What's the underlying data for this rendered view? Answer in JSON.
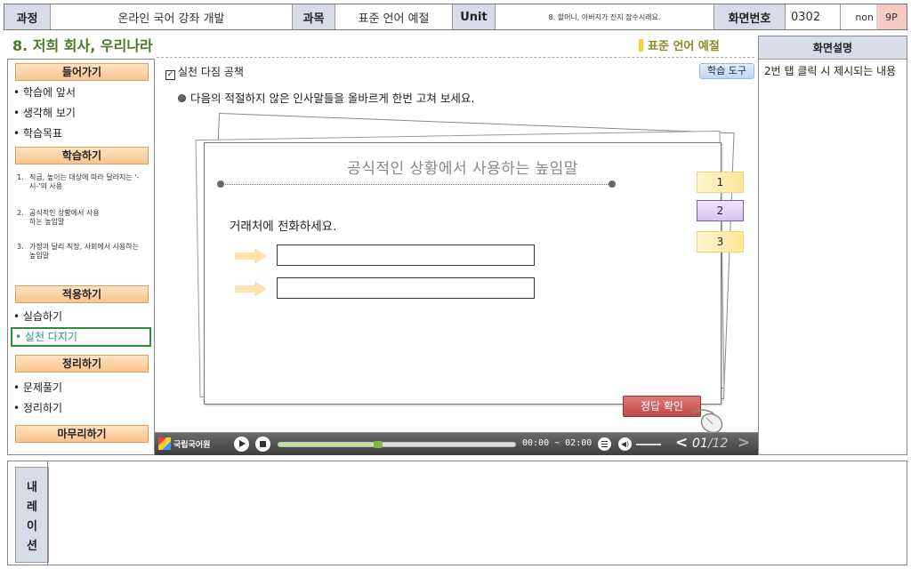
{
  "header": {
    "course_label": "과정",
    "course_value": "온라인 국어 강좌 개발",
    "subject_label": "과목",
    "subject_value": "표준 언어 예절",
    "unit_label": "Unit",
    "unit_value": "8. 할머니, 아버지가 진지 잡수시래요.",
    "screen_label": "화면번호",
    "screen_value": "0302",
    "non_label": "non",
    "page_label": "9P"
  },
  "page_title": "8. 저희 회사, 우리나라",
  "std_label": "표준 언어 예절",
  "nav": {
    "intro_btn": "들어가기",
    "intro_items": [
      "학습에 앞서",
      "생각해 보기",
      "학습목표"
    ],
    "learn_btn": "학습하기",
    "learn_items": [
      {
        "num": "1.",
        "text": "직급, 높이는 대상에 따라 달라지는 '-시-'의 사용"
      },
      {
        "num": "2.",
        "text": "공식적인 상황에서 사용하는 높임말"
      },
      {
        "num": "3.",
        "text": "가정과 달리 직장, 사회에서 사용하는 높임말"
      }
    ],
    "apply_btn": "적용하기",
    "apply_items": [
      "실습하기",
      "실천 다지기"
    ],
    "summary_btn": "정리하기",
    "summary_items": [
      "문제풀기",
      "정리하기"
    ],
    "finish_btn": "마무리하기"
  },
  "main": {
    "section_title": "실천 다짐 공책",
    "tool_button": "학습 도구",
    "instruction": "다음의 적절하지 않은 인사말들을 올바르게 한번 고쳐 보세요.",
    "card_title": "공식적인 상황에서 사용하는 높임말",
    "question": "거래처에 전화하세요.",
    "input1_value": "",
    "input2_value": "",
    "tabs": [
      "1",
      "2",
      "3"
    ],
    "answer_button": "정답 확인"
  },
  "player": {
    "logo_text": "국립국어원",
    "progress": 0.42,
    "time": "00:00 ~ 02:00",
    "current_page": "01",
    "total_pages": "12"
  },
  "desc": {
    "title": "화면설명",
    "body": "2번 탭 클릭 시 제시되는 내용"
  },
  "narration": {
    "label": "내레이션",
    "body": ""
  }
}
